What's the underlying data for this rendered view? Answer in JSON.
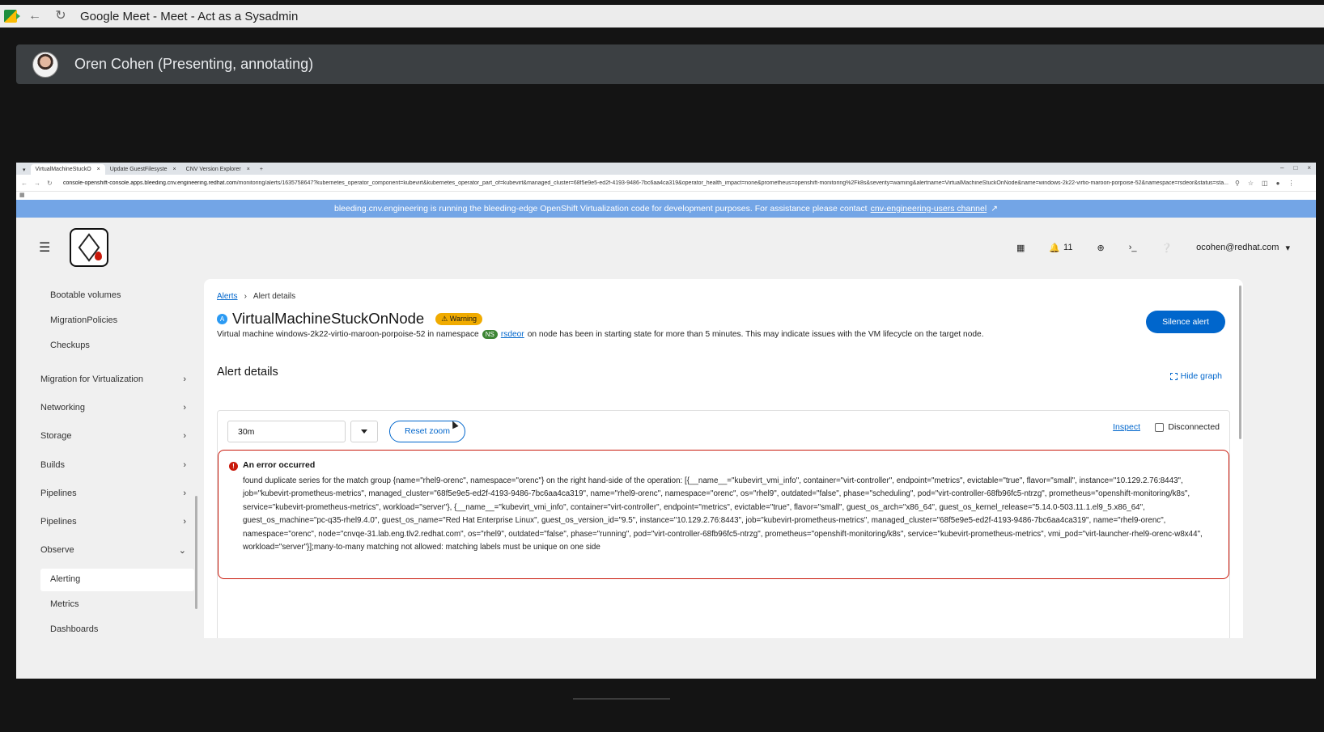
{
  "meet": {
    "window_title": "Google Meet - Meet - Act as a Sysadmin",
    "presenter": "Oren Cohen (Presenting, annotating)"
  },
  "browser": {
    "tabs": [
      {
        "label": "VirtualMachineStuckO"
      },
      {
        "label": "Update GuestFilesyste"
      },
      {
        "label": "CNV Version Explorer"
      }
    ],
    "url_host": "console-openshift-console.apps.bleeding.cnv.engineering.redhat.com",
    "url_path": "/monitoring/alerts/1635758647?kubernetes_operator_component=kubevirt&kubernetes_operator_part_of=kubevirt&managed_cluster=68f5e9e5-ed2f-4193-9486-7bc6aa4ca319&operator_health_impact=none&prometheus=openshift-monitoring%2Fk8s&severity=warning&alertname=VirtualMachineStuckOnNode&name=windows-2k22-virtio-maroon-porpoise-52&namespace=rsdeor&status=sta..."
  },
  "banner": {
    "text": "bleeding.cnv.engineering is running the bleeding-edge OpenShift Virtualization code for development purposes. For assistance please contact",
    "link": "cnv-engineering-users channel"
  },
  "masthead": {
    "notifications_count": "11",
    "user": "ocohen@redhat.com"
  },
  "sidebar": {
    "sub_top": [
      "Bootable volumes",
      "MigrationPolicies",
      "Checkups"
    ],
    "groups": [
      "Migration for Virtualization",
      "Networking",
      "Storage",
      "Builds",
      "Pipelines",
      "Pipelines",
      "Observe"
    ],
    "observe_items": [
      "Alerting",
      "Metrics",
      "Dashboards"
    ]
  },
  "page": {
    "breadcrumb_link": "Alerts",
    "breadcrumb_current": "Alert details",
    "badge_letter": "A",
    "title": "VirtualMachineStuckOnNode",
    "severity": "Warning",
    "desc_before": "Virtual machine windows-2k22-virtio-maroon-porpoise-52 in namespace",
    "ns_badge": "NS",
    "namespace": "rsdeor",
    "desc_after": "on node has been in starting state for more than 5 minutes. This may indicate issues with the VM lifecycle on the target node.",
    "silence_button": "Silence alert",
    "section_title": "Alert details",
    "hide_graph": "Hide graph"
  },
  "graph": {
    "span": "30m",
    "reset_zoom": "Reset zoom",
    "inspect": "Inspect",
    "disconnected": "Disconnected",
    "error_title": "An error occurred",
    "error_body": "found duplicate series for the match group {name=\"rhel9-orenc\", namespace=\"orenc\"} on the right hand-side of the operation: [{__name__=\"kubevirt_vmi_info\", container=\"virt-controller\", endpoint=\"metrics\", evictable=\"true\", flavor=\"small\", instance=\"10.129.2.76:8443\", job=\"kubevirt-prometheus-metrics\", managed_cluster=\"68f5e9e5-ed2f-4193-9486-7bc6aa4ca319\", name=\"rhel9-orenc\", namespace=\"orenc\", os=\"rhel9\", outdated=\"false\", phase=\"scheduling\", pod=\"virt-controller-68fb96fc5-ntrzg\", prometheus=\"openshift-monitoring/k8s\", service=\"kubevirt-prometheus-metrics\", workload=\"server\"}, {__name__=\"kubevirt_vmi_info\", container=\"virt-controller\", endpoint=\"metrics\", evictable=\"true\", flavor=\"small\", guest_os_arch=\"x86_64\", guest_os_kernel_release=\"5.14.0-503.11.1.el9_5.x86_64\", guest_os_machine=\"pc-q35-rhel9.4.0\", guest_os_name=\"Red Hat Enterprise Linux\", guest_os_version_id=\"9.5\", instance=\"10.129.2.76:8443\", job=\"kubevirt-prometheus-metrics\", managed_cluster=\"68f5e9e5-ed2f-4193-9486-7bc6aa4ca319\", name=\"rhel9-orenc\", namespace=\"orenc\", node=\"cnvqe-31.lab.eng.tlv2.redhat.com\", os=\"rhel9\", outdated=\"false\", phase=\"running\", pod=\"virt-controller-68fb96fc5-ntrzg\", prometheus=\"openshift-monitoring/k8s\", service=\"kubevirt-prometheus-metrics\", vmi_pod=\"virt-launcher-rhel9-orenc-w8x44\", workload=\"server\"}];many-to-many matching not allowed: matching labels must be unique on one side"
  }
}
